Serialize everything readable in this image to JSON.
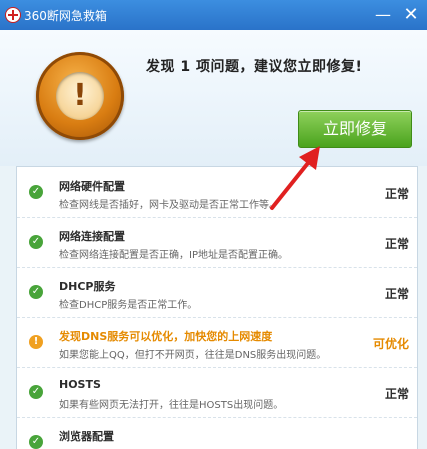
{
  "window": {
    "title": "360断网急救箱",
    "minimize_glyph": "—",
    "close_glyph": "✕"
  },
  "header": {
    "headline": "发现 1 项问题，建议您立即修复!",
    "fix_button": "立即修复",
    "warning_glyph": "!"
  },
  "colors": {
    "titlebar": "#2a73c9",
    "fix_button": "#4aa31d",
    "ok": "#48a43a",
    "warn": "#e58a00",
    "arrow": "#e02020"
  },
  "items": [
    {
      "title": "网络硬件配置",
      "desc": "检查网线是否插好，网卡及驱动是否正常工作等。",
      "status": "正常",
      "icon": "check-icon",
      "icon_glyph": "✓"
    },
    {
      "title": "网络连接配置",
      "desc": "检查网络连接配置是否正确，IP地址是否配置正确。",
      "status": "正常",
      "icon": "check-icon",
      "icon_glyph": "✓"
    },
    {
      "title": "DHCP服务",
      "desc": "检查DHCP服务是否正常工作。",
      "status": "正常",
      "icon": "check-icon",
      "icon_glyph": "✓"
    },
    {
      "title": "发现DNS服务可以优化，加快您的上网速度",
      "desc": "如果您能上QQ，但打不开网页，往往是DNS服务出现问题。",
      "status": "可优化",
      "icon": "warning-icon",
      "icon_glyph": "!"
    },
    {
      "title": "HOSTS",
      "desc": "如果有些网页无法打开，往往是HOSTS出现问题。",
      "status": "正常",
      "icon": "check-icon",
      "icon_glyph": "✓"
    },
    {
      "title": "浏览器配置",
      "desc": "",
      "status": "",
      "icon": "check-icon",
      "icon_glyph": "✓"
    }
  ]
}
